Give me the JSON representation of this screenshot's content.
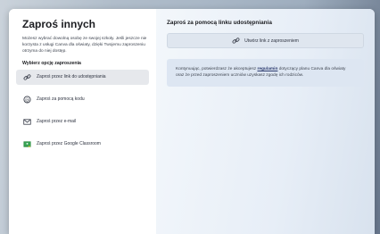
{
  "dialog": {
    "left": {
      "title": "Zaproś innych",
      "description": "Możesz wybrać dowolną osobę ze swojej szkoły. Jeśli jeszcze nie korzysta z usługi Canva dla oświaty, dzięki Twojemu zaproszeniu otrzyma do niej dostęp.",
      "section_title": "Wybierz opcję zaproszenia",
      "options": [
        {
          "label": "Zaproś przez link do udostępniania",
          "icon": "link-icon",
          "selected": true
        },
        {
          "label": "Zaproś za pomocą kodu",
          "icon": "code-icon",
          "selected": false
        },
        {
          "label": "Zaproś przez e-mail",
          "icon": "email-icon",
          "selected": false
        },
        {
          "label": "Zaproś przez Google Classroom",
          "icon": "google-classroom-icon",
          "selected": false
        }
      ]
    },
    "right": {
      "title": "Zaproś za pomocą linku udostępniania",
      "create_link_button": "Utwórz link z zaproszeniem",
      "notice_before": "Kontynuując, potwierdzasz że akceptujesz ",
      "notice_link": "regulamin",
      "notice_after": " dotyczący planu Canva dla oświaty oraz że przed zaproszeniem uczniów uzyskasz zgodę ich rodziców."
    }
  },
  "colors": {
    "accent_green": "#2f8f46",
    "selected_bg": "#e6e8ec",
    "panel_bg": "#e7eef7"
  }
}
